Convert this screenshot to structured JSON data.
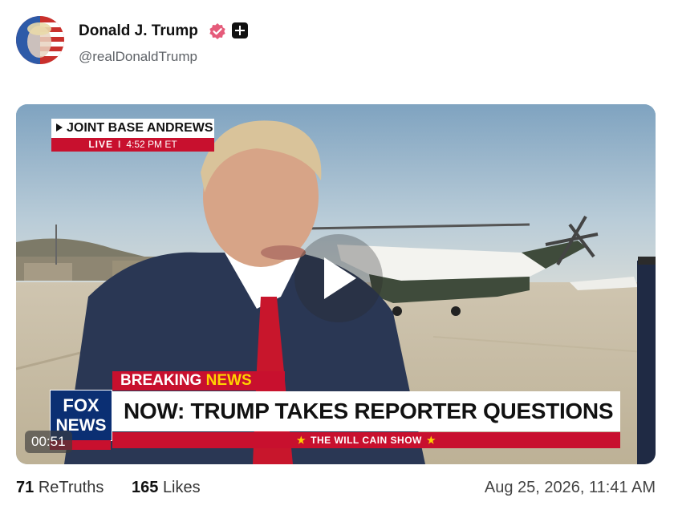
{
  "post": {
    "author": {
      "display_name": "Donald J. Trump",
      "handle": "@realDonaldTrump",
      "verified": true,
      "verified_color": "#e55b7a"
    },
    "video": {
      "location_banner": {
        "title": "JOINT BASE ANDREWS",
        "live_label": "LIVE",
        "time": "4:52 PM ET"
      },
      "breaking_label": "BREAKING",
      "breaking_news_label": "NEWS",
      "headline": "NOW: TRUMP TAKES REPORTER QUESTIONS",
      "show_name": "THE WILL CAIN SHOW",
      "network_logo_line1": "FOX",
      "network_logo_line2": "NEWS",
      "duration": "00:51",
      "play_icon": "play-icon"
    },
    "stats": {
      "retruths_count": "71",
      "retruths_label": "ReTruths",
      "likes_count": "165",
      "likes_label": "Likes"
    },
    "timestamp": "Aug 25, 2026, 11:41 AM"
  },
  "colors": {
    "fox_red": "#c8102e",
    "fox_blue": "#0b2f73",
    "accent_yellow": "#ffd200"
  }
}
